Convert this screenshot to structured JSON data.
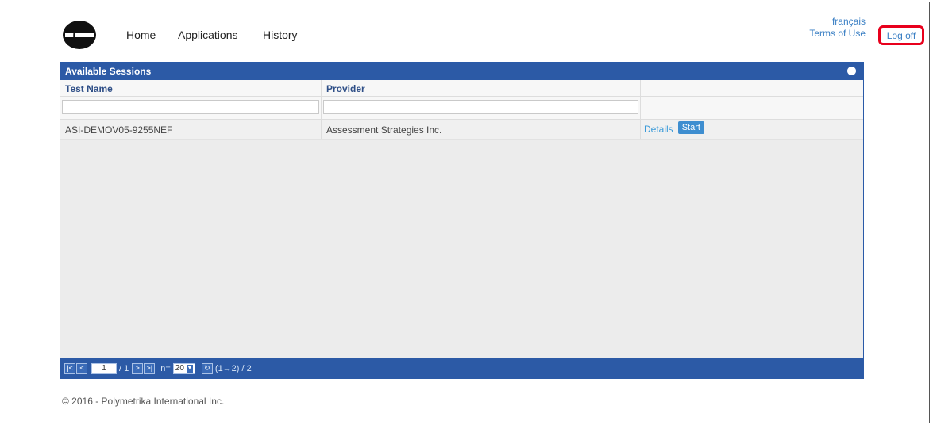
{
  "nav": {
    "home": "Home",
    "applications": "Applications",
    "history": "History"
  },
  "top_right": {
    "language": "français",
    "terms": "Terms of Use",
    "logoff": "Log off"
  },
  "panel": {
    "title": "Available Sessions",
    "columns": [
      "Test Name",
      "Provider"
    ],
    "rows": [
      {
        "test_name": "ASI-DEMOV05-9255NEF",
        "provider": "Assessment Strategies Inc.",
        "details_label": "Details",
        "start_label": "Start"
      }
    ]
  },
  "pager": {
    "first": "|<",
    "prev": "<",
    "page_value": "1",
    "page_total": "/ 1",
    "next": ">",
    "last": ">|",
    "size_label": "n=",
    "size_value": "20",
    "refresh": "↻",
    "range": "(1→2) / 2"
  },
  "footer": "© 2016 - Polymetrika International Inc.",
  "colors": {
    "brand_blue": "#2c5aa6",
    "link_blue": "#3a7fc4",
    "highlight_red": "#e8001c"
  }
}
